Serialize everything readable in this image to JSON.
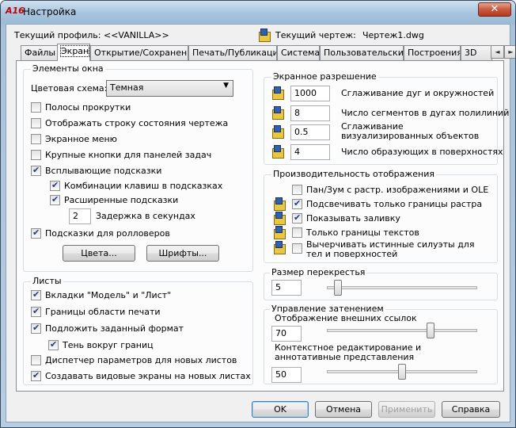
{
  "window": {
    "title": "Настройка",
    "logo_text": "A16",
    "close_glyph": "✕"
  },
  "profile": {
    "label": "Текущий профиль:",
    "value": "<<VANILLA>>",
    "drawing_label": "Текущий чертеж:",
    "drawing_value": "Чертеж1.dwg"
  },
  "tabs": [
    "Файлы",
    "Экран",
    "Открытие/Сохранение",
    "Печать/Публикация",
    "Система",
    "Пользовательские",
    "Построения",
    "3D"
  ],
  "tab_scroll": {
    "left": "◄",
    "right": "►"
  },
  "window_elements": {
    "title": "Элементы окна",
    "scheme_label": "Цветовая схема:",
    "scheme_value": "Темная",
    "scrollbars": "Полосы прокрутки",
    "statusbar": "Отображать строку состояния чертежа",
    "screen_menu": "Экранное меню",
    "large_buttons": "Крупные кнопки для панелей задач",
    "tooltips": "Всплывающие подсказки",
    "shortcut_tooltips": "Комбинации клавиш в подсказках",
    "extended_tooltips": "Расширенные подсказки",
    "delay_value": "2",
    "delay_label": "Задержка в секундах",
    "rollover": "Подсказки для ролловеров",
    "colors_btn": "Цвета...",
    "fonts_btn": "Шрифты..."
  },
  "layouts": {
    "title": "Листы",
    "model_tabs": "Вкладки \"Модель\" и \"Лист\"",
    "print_area": "Границы области печати",
    "paper_bg": "Подложить заданный формат",
    "shadow": "Тень вокруг границ",
    "page_setup": "Диспетчер параметров для новых листов",
    "viewports": "Создавать видовые экраны на новых листах"
  },
  "resolution": {
    "title": "Экранное разрешение",
    "arc_value": "1000",
    "arc_label": "Сглаживание дуг и окружностей",
    "segments_value": "8",
    "segments_label": "Число сегментов в дугах полилиний",
    "smooth_value": "0.5",
    "smooth_label": "Сглаживание визуализированных объектов",
    "contour_value": "4",
    "contour_label": "Число образующих в поверхностях"
  },
  "performance": {
    "title": "Производительность отображения",
    "panzoom": "Пан/Зум с растр. изображениями и OLE",
    "highlight": "Подсвечивать только границы растра",
    "fill": "Показывать заливку",
    "text_frames": "Только границы текстов",
    "silhouettes": "Вычерчивать истинные силуэты для тел и поверхностей"
  },
  "crosshair": {
    "title": "Размер перекрестья",
    "value": "5",
    "fraction": 0.05
  },
  "fading": {
    "title": "Управление затенением",
    "xref_label": "Отображение внешних ссылок",
    "xref_value": "70",
    "xref_fraction": 0.7,
    "inplace_label": "Контекстное редактирование и аннотативные представления",
    "inplace_value": "50",
    "inplace_fraction": 0.5
  },
  "buttons": {
    "ok": "OK",
    "cancel": "Отмена",
    "apply": "Применить",
    "help": "Справка"
  }
}
